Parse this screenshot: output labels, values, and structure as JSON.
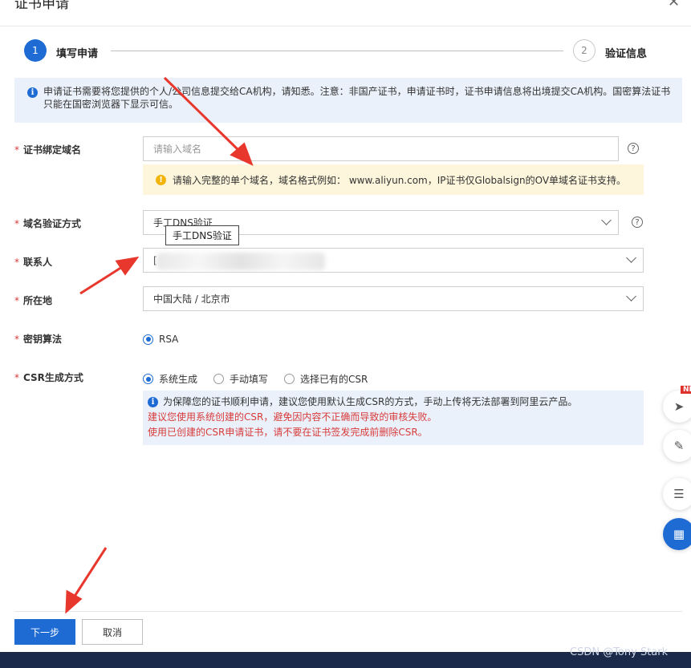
{
  "dialog": {
    "title": "证书申请",
    "close_icon": "close-icon"
  },
  "steps": [
    {
      "number": "1",
      "label": "填写申请"
    },
    {
      "number": "2",
      "label": "验证信息"
    }
  ],
  "notice": {
    "text": "申请证书需要将您提供的个人/公司信息提交给CA机构，请知悉。注意：非国产证书，申请证书时，证书申请信息将出境提交CA机构。国密算法证书只能在国密浏览器下显示可信。"
  },
  "form": {
    "domain": {
      "label": "证书绑定域名",
      "placeholder": "请输入域名",
      "warning": "请输入完整的单个域名，域名格式例如： www.aliyun.com，IP证书仅Globalsign的OV单域名证书支持。"
    },
    "verify_method": {
      "label": "域名验证方式",
      "value": "手工DNS验证",
      "tooltip": "手工DNS验证"
    },
    "contact": {
      "label": "联系人",
      "value": "["
    },
    "location": {
      "label": "所在地",
      "value": "中国大陆 / 北京市"
    },
    "key_algorithm": {
      "label": "密钥算法",
      "options": [
        "RSA"
      ],
      "selected": "RSA"
    },
    "csr_method": {
      "label": "CSR生成方式",
      "options": [
        "系统生成",
        "手动填写",
        "选择已有的CSR"
      ],
      "selected": "系统生成",
      "info": "为保障您的证书顺利申请，建议您使用默认生成CSR的方式，手动上传将无法部署到阿里云产品。",
      "warning1": "建议您使用系统创建的CSR，避免因内容不正确而导致的审核失败。",
      "warning2": "使用已创建的CSR申请证书，请不要在证书签发完成前删除CSR。"
    }
  },
  "buttons": {
    "next": "下一步",
    "cancel": "取消"
  },
  "side_toolbar": {
    "new_badge": "NE"
  },
  "watermark": "CSDN @Tony Stark",
  "colors": {
    "primary": "#1f6bd4",
    "required": "#d83b3b",
    "annotation_arrow": "#e8372c"
  }
}
